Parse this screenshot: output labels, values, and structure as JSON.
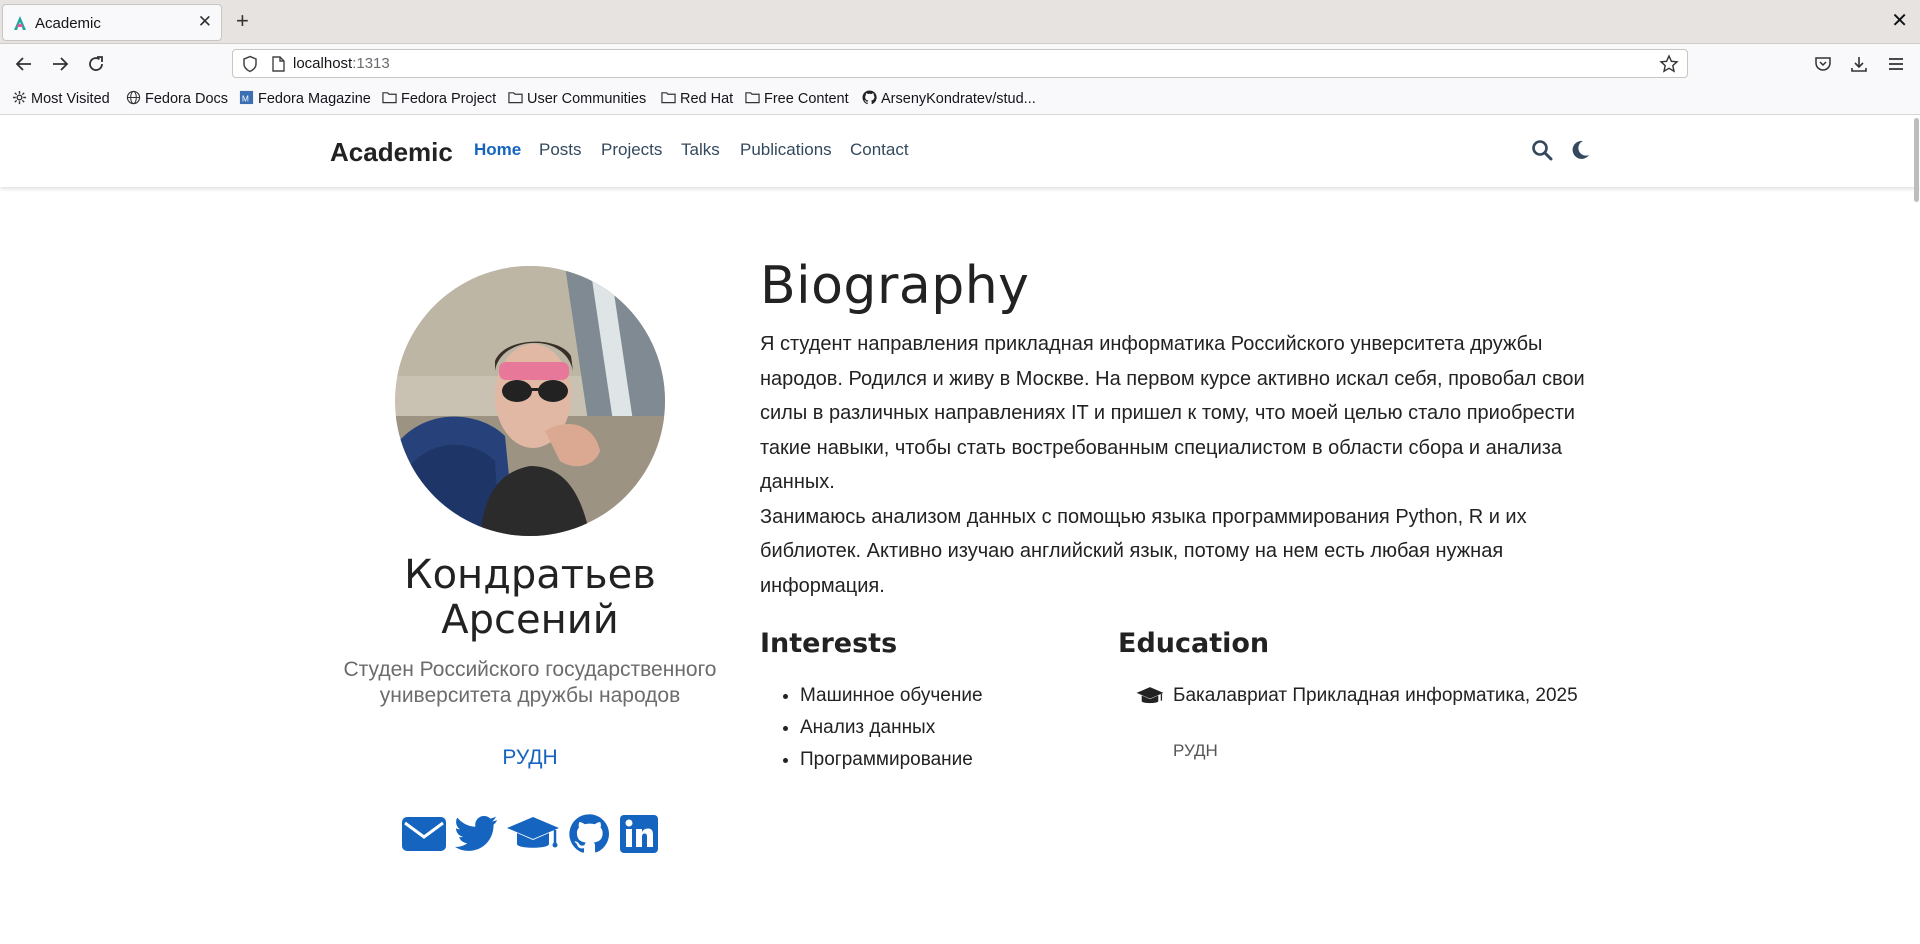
{
  "browser": {
    "tab_title": "Academic",
    "url_host": "localhost",
    "url_port": ":1313",
    "bookmarks": [
      {
        "label": "Most Visited",
        "icon": "gear-icon"
      },
      {
        "label": "Fedora Docs",
        "icon": "globe-icon"
      },
      {
        "label": "Fedora Magazine",
        "icon": "fedora-magazine-icon"
      },
      {
        "label": "Fedora Project",
        "icon": "folder-icon"
      },
      {
        "label": "User Communities",
        "icon": "folder-icon"
      },
      {
        "label": "Red Hat",
        "icon": "folder-icon"
      },
      {
        "label": "Free Content",
        "icon": "folder-icon"
      },
      {
        "label": "ArsenyKondratev/stud...",
        "icon": "github-icon"
      }
    ]
  },
  "site": {
    "brand": "Academic",
    "menu": [
      "Home",
      "Posts",
      "Projects",
      "Talks",
      "Publications",
      "Contact"
    ],
    "active_menu": "Home",
    "accent_color": "#1565c0"
  },
  "profile": {
    "name_line1": "Кондратьев",
    "name_line2": "Арсений",
    "role": "Студен Российского государственного университета дружбы народов",
    "organization": "РУДН",
    "social": [
      "email-icon",
      "twitter-icon",
      "graduation-cap-icon",
      "github-icon",
      "linkedin-icon"
    ]
  },
  "biography": {
    "title": "Biography",
    "paragraph1": "Я студент направления прикладная информатика Российского унверситета дружбы народов. Родился и живу в Москве. На первом курсе активно искал себя, провобал свои силы в различных направлениях IT и пришел к тому, что моей целью стало приобрести такие навыки, чтобы стать востребованным специалистом в области сбора и анализа данных.",
    "paragraph2": "Занимаюсь анализом данных с помощью языка программирования Python, R и их библиотек. Активно изучаю английский язык, потому на нем есть любая нужная информация."
  },
  "interests": {
    "title": "Interests",
    "items": [
      "Машинное обучение",
      "Анализ данных",
      "Программирование"
    ]
  },
  "education": {
    "title": "Education",
    "course": "Бакалавриат Прикладная информатика, 2025",
    "institution": "РУДН"
  }
}
